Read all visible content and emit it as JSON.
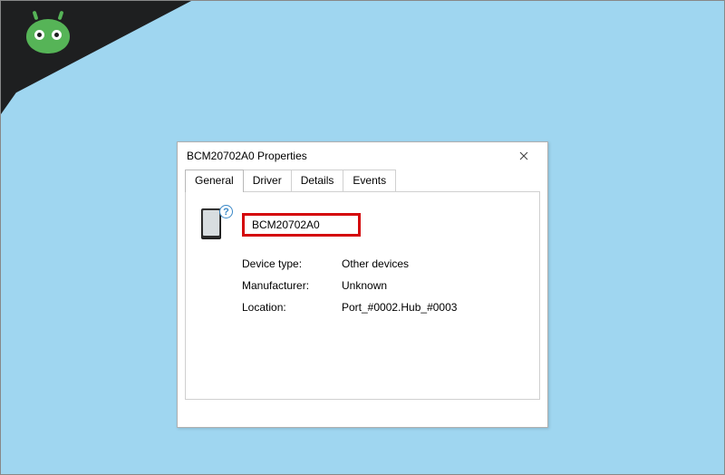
{
  "dialog": {
    "title": "BCM20702A0 Properties",
    "device_name": "BCM20702A0",
    "device_icon_question": "?",
    "tabs": [
      {
        "label": "General"
      },
      {
        "label": "Driver"
      },
      {
        "label": "Details"
      },
      {
        "label": "Events"
      }
    ],
    "info": {
      "device_type_label": "Device type:",
      "device_type_value": "Other devices",
      "manufacturer_label": "Manufacturer:",
      "manufacturer_value": "Unknown",
      "location_label": "Location:",
      "location_value": "Port_#0002.Hub_#0003"
    }
  }
}
